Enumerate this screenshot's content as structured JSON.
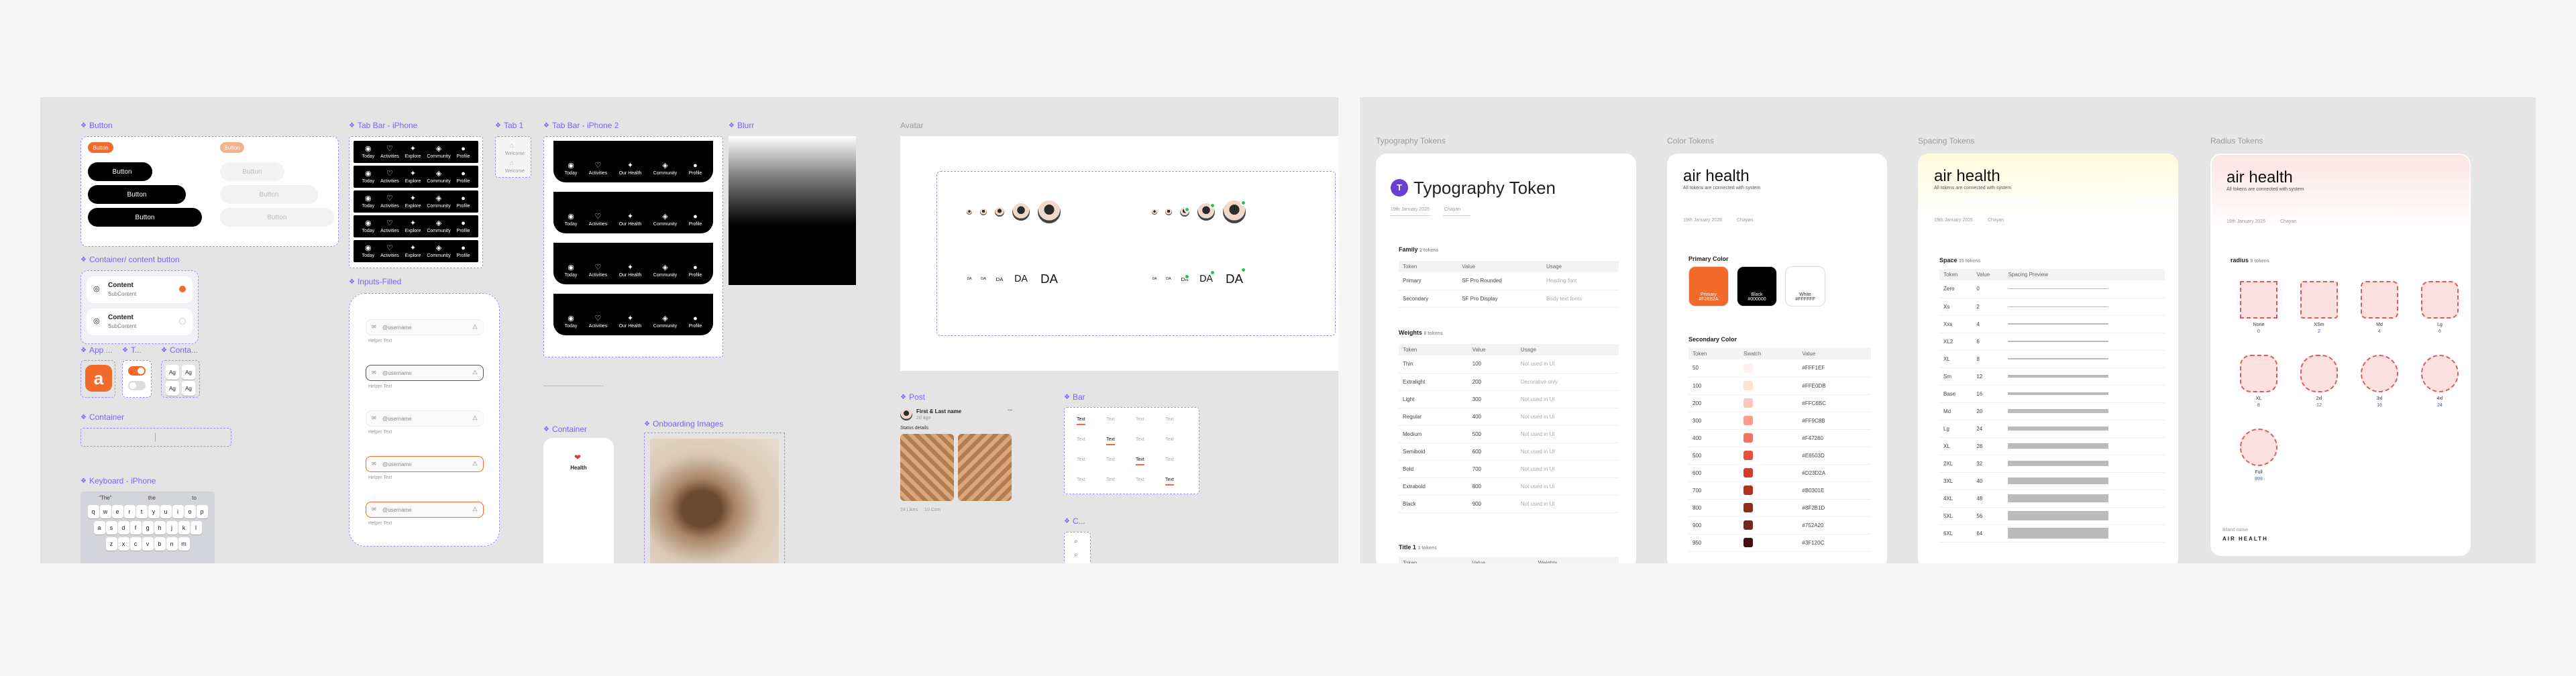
{
  "left_frames": {
    "button": {
      "label": "Button",
      "pill_label": "Button",
      "dark_buttons": [
        "Button",
        "Button",
        "Button"
      ],
      "disabled_buttons": [
        "Button",
        "Button",
        "Button"
      ]
    },
    "container_content_button": {
      "label": "Container/ content button",
      "items": [
        {
          "title": "Content",
          "sub": "SubContent"
        },
        {
          "title": "Content",
          "sub": "SubContent"
        }
      ]
    },
    "app_icon": {
      "label": "App ..."
    },
    "toggle": {
      "label": "T..."
    },
    "contact": {
      "label": "Conta...",
      "keys": [
        "Ag",
        "Ag",
        "Ag",
        "Ag"
      ]
    },
    "container": {
      "label": "Container"
    },
    "keyboard": {
      "label": "Keyboard - iPhone",
      "suggestions": [
        "\"The\"",
        "the",
        "to"
      ],
      "rows": [
        [
          "q",
          "w",
          "e",
          "r",
          "t",
          "y",
          "u",
          "i",
          "o",
          "p"
        ],
        [
          "a",
          "s",
          "d",
          "f",
          "g",
          "h",
          "j",
          "k",
          "l"
        ],
        [
          "z",
          "x",
          "c",
          "v",
          "b",
          "n",
          "m"
        ]
      ]
    },
    "tab_bar": {
      "label": "Tab Bar - iPhone",
      "tabs": [
        "Today",
        "Activities",
        "Explore",
        "Community",
        "Profile"
      ]
    },
    "tab1": {
      "label": "Tab 1",
      "item": "Welcome"
    },
    "tab_bar2": {
      "label": "Tab Bar - iPhone 2",
      "tabs": [
        "Today",
        "Activities",
        "Our Health",
        "Community",
        "Profile"
      ]
    },
    "inputs_filled": {
      "label": "Inputs-Filled",
      "value": "@username",
      "helper": "Helper Text"
    },
    "blur": {
      "label": "Blurr"
    },
    "avatar": {
      "label": "Avatar",
      "initials": "DA"
    },
    "post": {
      "label": "Post",
      "author": "First & Last name",
      "meta": "2d ago",
      "caption": "Status details",
      "likes": "24 Likes",
      "comments": "10 Com"
    },
    "bar": {
      "label": "Bar",
      "tab_text": "Text"
    },
    "container2": {
      "label": "Container",
      "title": "Health"
    },
    "onboarding": {
      "label": "Onboarding Images"
    },
    "c_small": {
      "label": "C..."
    }
  },
  "sections": {
    "typography": {
      "label": "Typography Tokens",
      "title": "Typography Token",
      "meta": [
        "19th January 2026",
        "Chayan"
      ],
      "family_heading": "Family",
      "family_count": "2 tokens",
      "family_cols": [
        "Token",
        "Value",
        "Usage"
      ],
      "family_rows": [
        [
          "Primary",
          "SF Pro Rounded",
          "Heading font"
        ],
        [
          "Secondary",
          "SF Pro Display",
          "Body text fonts"
        ]
      ],
      "weights_heading": "Weights",
      "weights_count": "8 tokens",
      "weights_cols": [
        "Token",
        "Value",
        "Usage"
      ],
      "weights_rows": [
        [
          "Thin",
          "100",
          "Not used in UI"
        ],
        [
          "Extralight",
          "200",
          "Decorative only"
        ],
        [
          "Light",
          "300",
          "Not used in UI"
        ],
        [
          "Regular",
          "400",
          "Not used in UI"
        ],
        [
          "Medium",
          "500",
          "Not used in UI"
        ],
        [
          "Semibold",
          "600",
          "Not used in UI"
        ],
        [
          "Bold",
          "700",
          "Not used in UI"
        ],
        [
          "Extrabold",
          "800",
          "Not used in UI"
        ],
        [
          "Black",
          "900",
          "Not used in UI"
        ]
      ],
      "title1_heading": "Title 1",
      "title1_count": "3 tokens",
      "title1_cols": [
        "Token",
        "Value",
        "Weights"
      ]
    },
    "color": {
      "label": "Color Tokens",
      "brand": "air health",
      "tagline": "All tokens are connected with system",
      "meta": [
        "19th January 2026",
        "Chayan"
      ],
      "primary_heading": "Primary Color",
      "primary": [
        {
          "name": "Primary",
          "hex": "#F26B2A",
          "text": "Primary\n#F26B2A"
        },
        {
          "name": "Black",
          "hex": "#000000",
          "text": "Black\n#000000"
        },
        {
          "name": "White",
          "hex": "#FFFFFF",
          "text": "White\n#FFFFFF"
        }
      ],
      "secondary_heading": "Secondary Color",
      "secondary_cols": [
        "Token",
        "Swatch",
        "Value"
      ],
      "secondary_rows": [
        [
          "50",
          "#FFF1EF",
          "#FFF1EF"
        ],
        [
          "100",
          "#FFE0DB",
          "#FFE0DB"
        ],
        [
          "200",
          "#FFC6BC",
          "#FFC6BC"
        ],
        [
          "300",
          "#FF9C8B",
          "#FF9C8B"
        ],
        [
          "400",
          "#F47260",
          "#F47260"
        ],
        [
          "500",
          "#E6503D",
          "#E6503D"
        ],
        [
          "600",
          "#D23D2A",
          "#D23D2A"
        ],
        [
          "700",
          "#B0301E",
          "#B0301E"
        ],
        [
          "800",
          "#8F2B1D",
          "#8F2B1D"
        ],
        [
          "900",
          "#752A20",
          "#752A20"
        ],
        [
          "950",
          "#3F120C",
          "#3F120C"
        ]
      ]
    },
    "spacing": {
      "label": "Spacing Tokens",
      "brand": "air health",
      "tagline": "All tokens are connected with system",
      "meta": [
        "19th January 2026",
        "Chayan"
      ],
      "heading": "Space",
      "count": "15 tokens",
      "cols": [
        "Token",
        "Value",
        "Spacing Preview"
      ],
      "rows": [
        [
          "Zero",
          "0",
          0
        ],
        [
          "Xs",
          "2",
          2
        ],
        [
          "Xxs",
          "4",
          4
        ],
        [
          "XL2",
          "6",
          6
        ],
        [
          "XL",
          "8",
          8
        ],
        [
          "Sm",
          "12",
          12
        ],
        [
          "Base",
          "16",
          16
        ],
        [
          "Md",
          "20",
          20
        ],
        [
          "Lg",
          "24",
          24
        ],
        [
          "XL",
          "28",
          28
        ],
        [
          "2XL",
          "32",
          32
        ],
        [
          "3XL",
          "40",
          40
        ],
        [
          "4XL",
          "48",
          48
        ],
        [
          "5XL",
          "56",
          56
        ],
        [
          "6XL",
          "64",
          64
        ]
      ]
    },
    "radius": {
      "label": "Radius Tokens",
      "brand": "air health",
      "tagline": "All tokens are connected with system",
      "meta": [
        "19th January 2026",
        "Chayan"
      ],
      "heading": "radius",
      "count": "9 tokens",
      "items": [
        {
          "name": "None",
          "value": "0",
          "r": 0
        },
        {
          "name": "XSm",
          "value": "2",
          "r": 2
        },
        {
          "name": "Md",
          "value": "4",
          "r": 4
        },
        {
          "name": "Lg",
          "value": "6",
          "r": 6
        },
        {
          "name": "XL",
          "value": "8",
          "r": 8
        },
        {
          "name": "2xl",
          "value": "12",
          "r": 12
        },
        {
          "name": "3xl",
          "value": "16",
          "r": 16
        },
        {
          "name": "4xl",
          "value": "24",
          "r": 24
        },
        {
          "name": "Full",
          "value": "999",
          "r": 999
        }
      ],
      "footer_small": "Brand name",
      "footer": "AIR HEALTH"
    }
  }
}
